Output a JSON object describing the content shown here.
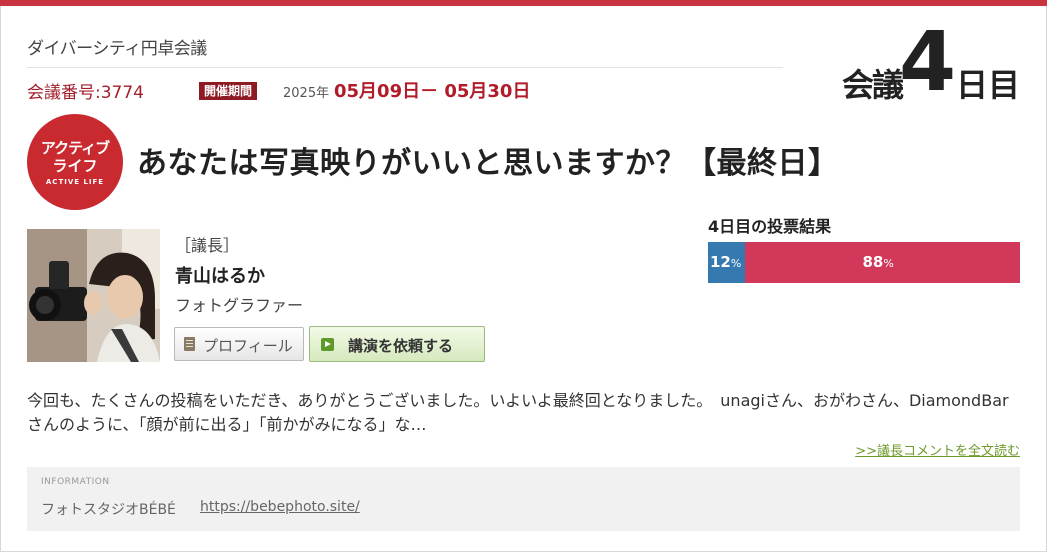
{
  "header": {
    "council_name": "ダイバーシティ円卓会議",
    "meeting_number": "会議番号:3774",
    "period_badge": "開催期間",
    "period_year": "2025年",
    "period_dates": "05月09日－ 05月30日",
    "day_counter": {
      "prefix": "会議",
      "number": "4",
      "suffix": "日目"
    }
  },
  "category_logo": {
    "line1": "アクティブ",
    "line2": "ライフ",
    "line3": "ACTIVE LIFE"
  },
  "topic_title": "あなたは写真映りがいいと思いますか？【最終日】",
  "chair": {
    "tag": "［議長］",
    "name": "青山はるか",
    "role": "フォトグラファー",
    "profile_button": "プロフィール",
    "lecture_button": "講演を依頼する"
  },
  "vote": {
    "title": "4日目の投票結果",
    "yes_percent": 12,
    "no_percent": 88,
    "yes_label": "12",
    "no_label": "88",
    "unit": "%",
    "colors": {
      "yes": "#3579b0",
      "no": "#d1385a"
    }
  },
  "comment": {
    "text": "今回も、たくさんの投稿をいただき、ありがとうございました。いよいよ最終回となりました。　unagiさん、おがわさん、DiamondBarさんのように、「顔が前に出る」「前かがみになる」な…",
    "read_more": ">>議長コメントを全文読む"
  },
  "info": {
    "heading": "INFORMATION",
    "studio_name": "フォトスタジオBÉBÉ",
    "link": "https://bebephoto.site/"
  },
  "accent_color": "#c8333f"
}
